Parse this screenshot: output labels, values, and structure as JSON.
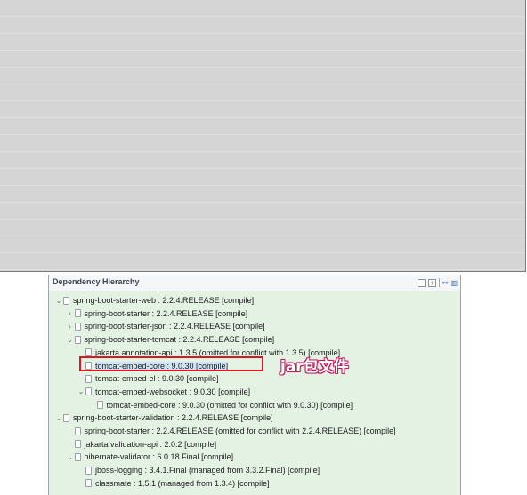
{
  "panel": {
    "title": "Dependency Hierarchy",
    "tools": [
      "collapse-all-icon",
      "expand-all-icon",
      "hierarchy-view-icon",
      "list-view-icon"
    ]
  },
  "tree": [
    {
      "label": "spring-boot-starter-web : 2.2.4.RELEASE [compile]",
      "level": 0,
      "expander": "expanded"
    },
    {
      "label": "spring-boot-starter : 2.2.4.RELEASE [compile]",
      "level": 1,
      "expander": "collapsed"
    },
    {
      "label": "spring-boot-starter-json : 2.2.4.RELEASE [compile]",
      "level": 1,
      "expander": "collapsed"
    },
    {
      "label": "spring-boot-starter-tomcat : 2.2.4.RELEASE [compile]",
      "level": 1,
      "expander": "expanded"
    },
    {
      "label": "jakarta.annotation-api : 1.3.5 (omitted for conflict with 1.3.5) [compile]",
      "level": 2,
      "expander": "none"
    },
    {
      "label": "tomcat-embed-core : 9.0.30 [compile]",
      "level": 2,
      "expander": "none",
      "selected": true
    },
    {
      "label": "tomcat-embed-el : 9.0.30 [compile]",
      "level": 2,
      "expander": "none"
    },
    {
      "label": "tomcat-embed-websocket : 9.0.30 [compile]",
      "level": 2,
      "expander": "expanded"
    },
    {
      "label": "tomcat-embed-core : 9.0.30 (omitted for conflict with 9.0.30) [compile]",
      "level": 3,
      "expander": "none"
    },
    {
      "label": "spring-boot-starter-validation : 2.2.4.RELEASE [compile]",
      "level": 0,
      "expander": "expanded"
    },
    {
      "label": "spring-boot-starter : 2.2.4.RELEASE (omitted for conflict with 2.2.4.RELEASE) [compile]",
      "level": 1,
      "expander": "none"
    },
    {
      "label": "jakarta.validation-api : 2.0.2 [compile]",
      "level": 1,
      "expander": "none"
    },
    {
      "label": "hibernate-validator : 6.0.18.Final [compile]",
      "level": 1,
      "expander": "expanded"
    },
    {
      "label": "jboss-logging : 3.4.1.Final (managed from 3.3.2.Final) [compile]",
      "level": 2,
      "expander": "none"
    },
    {
      "label": "classmate : 1.5.1 (managed from 1.3.4) [compile]",
      "level": 2,
      "expander": "none"
    }
  ],
  "annotation": {
    "text": "jar包文件",
    "color": "#c2185b"
  },
  "colors": {
    "panel_bg": "#e3f2e3",
    "highlight_border": "#e0161c"
  }
}
